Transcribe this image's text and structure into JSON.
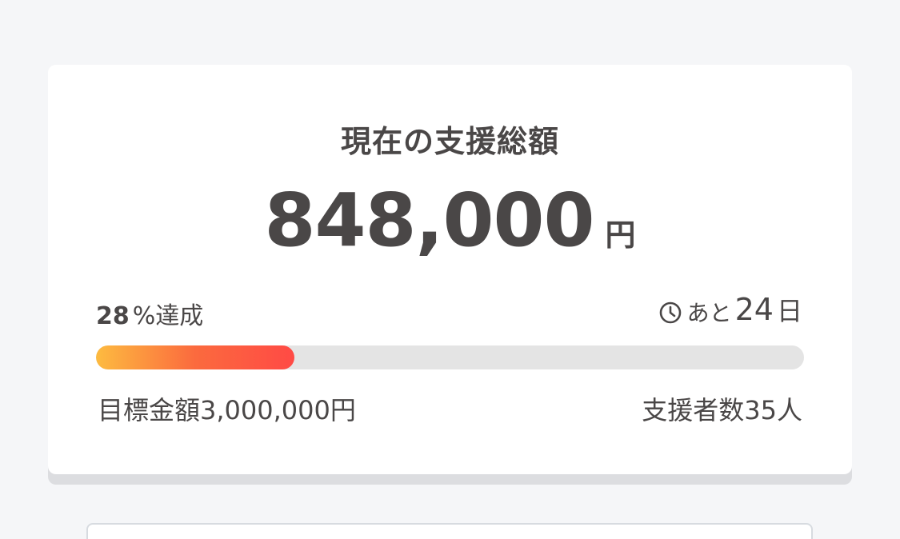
{
  "funding": {
    "title": "現在の支援総額",
    "amount": "848,000",
    "currency": "円",
    "achievement_number": "28",
    "achievement_suffix": "%",
    "achievement_label": "達成",
    "progress_percent": 28,
    "remaining_prefix": "あと",
    "remaining_days": "24",
    "remaining_unit": "日",
    "goal_text": "目標金額3,000,000円",
    "backers_text": "支援者数35人",
    "clock_icon": "clock-icon"
  },
  "colors": {
    "progress_start": "#fdbb40",
    "progress_end": "#ff4a45",
    "track": "#e4e4e4"
  }
}
